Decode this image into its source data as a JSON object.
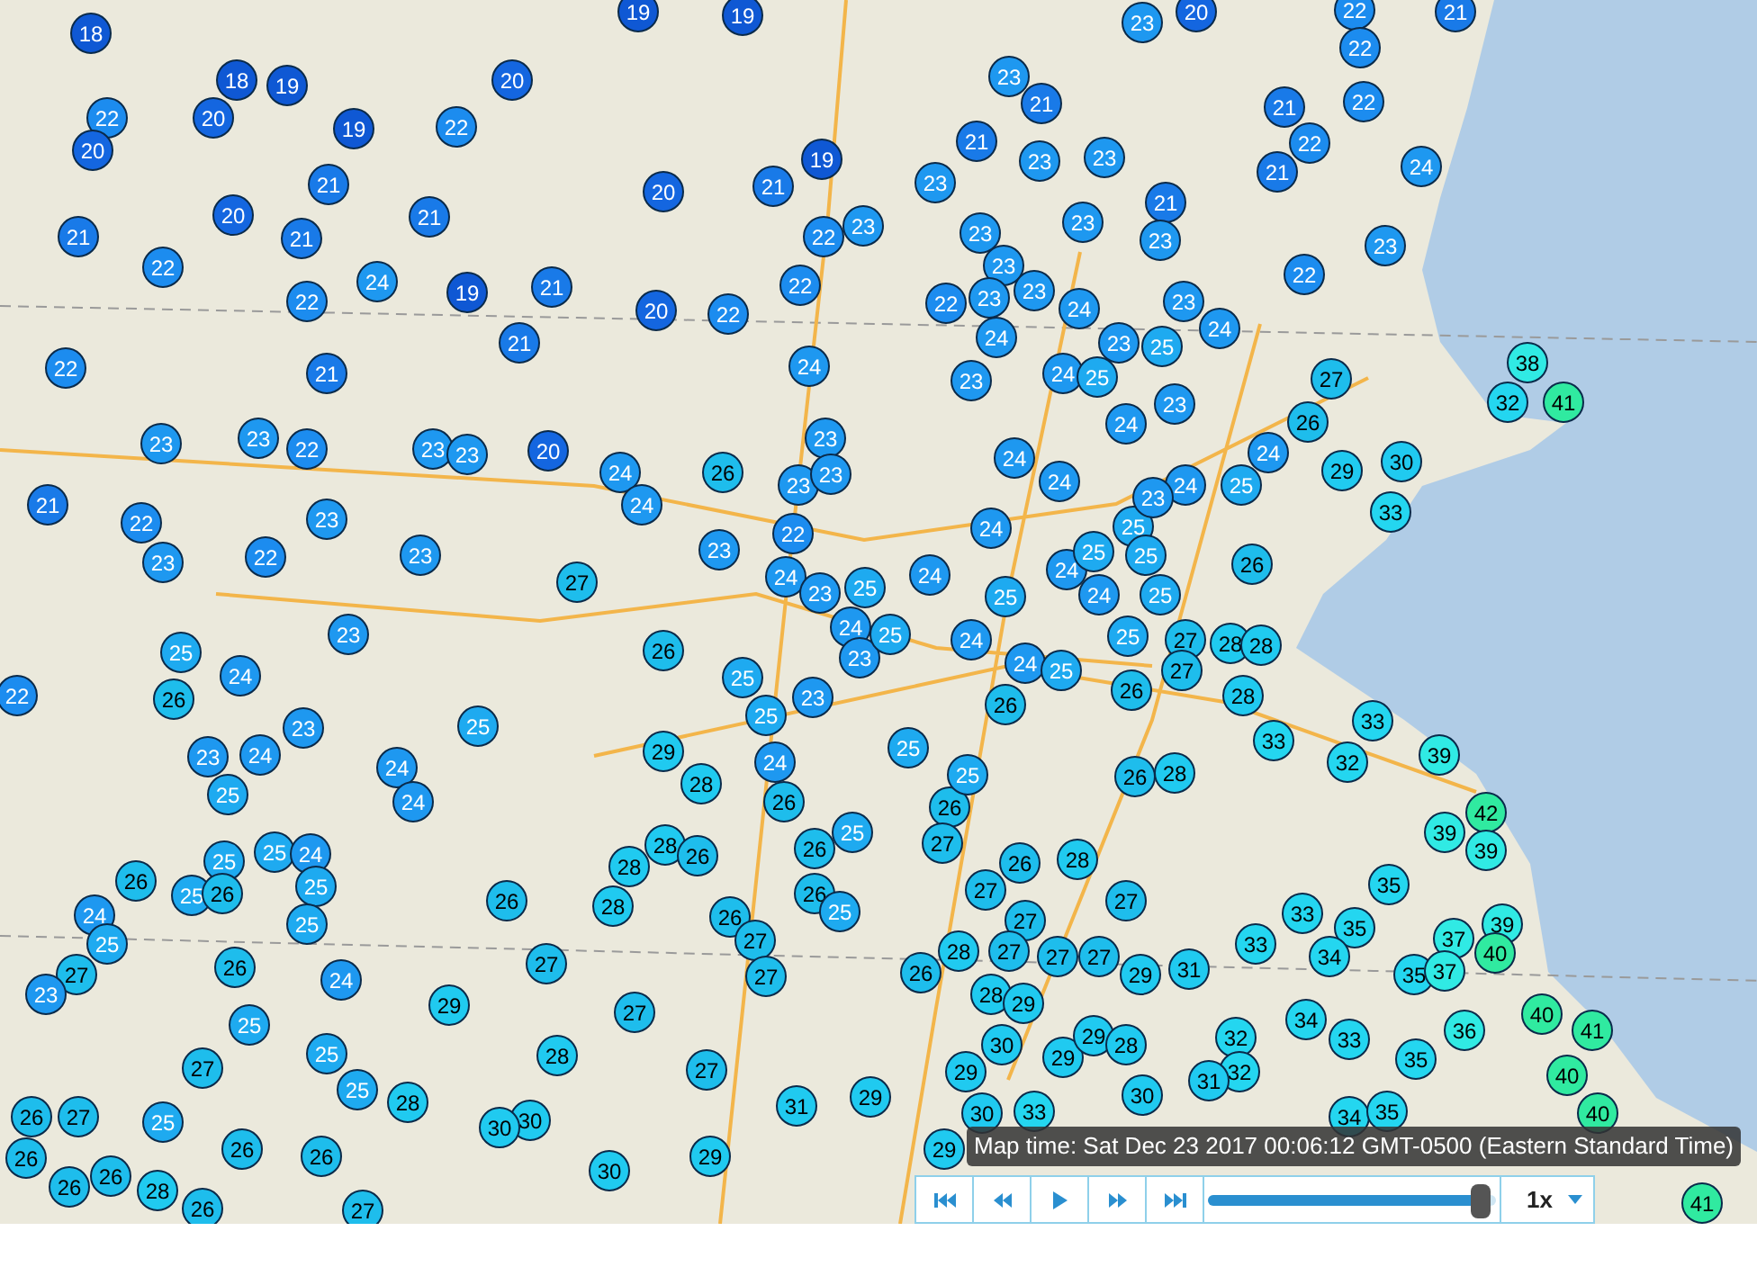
{
  "stations": [
    "18",
    "19",
    "19",
    "23",
    "20",
    "22",
    "21",
    "18",
    "19",
    "20",
    "23",
    "22",
    "22",
    "20",
    "19",
    "22",
    "21",
    "21",
    "22",
    "20",
    "19",
    "21",
    "23",
    "23",
    "21",
    "22",
    "24",
    "20",
    "21",
    "21",
    "20",
    "21",
    "23",
    "23",
    "21",
    "21",
    "22",
    "21",
    "22",
    "23",
    "23",
    "23",
    "23",
    "23",
    "22",
    "24",
    "19",
    "21",
    "20",
    "22",
    "22",
    "22",
    "23",
    "23",
    "24",
    "23",
    "22",
    "21",
    "24",
    "23",
    "25",
    "24",
    "22",
    "21",
    "24",
    "23",
    "24",
    "25",
    "23",
    "27",
    "32",
    "38",
    "41",
    "23",
    "23",
    "22",
    "23",
    "23",
    "24",
    "26",
    "23",
    "20",
    "24",
    "26",
    "23",
    "23",
    "24",
    "24",
    "24",
    "25",
    "24",
    "29",
    "30",
    "21",
    "22",
    "23",
    "24",
    "22",
    "24",
    "25",
    "23",
    "33",
    "23",
    "22",
    "23",
    "27",
    "23",
    "24",
    "24",
    "24",
    "25",
    "25",
    "26",
    "23",
    "24",
    "25",
    "25",
    "24",
    "25",
    "25",
    "23",
    "26",
    "23",
    "25",
    "24",
    "24",
    "25",
    "25",
    "27",
    "27",
    "28",
    "28",
    "22",
    "26",
    "24",
    "25",
    "25",
    "23",
    "26",
    "26",
    "28",
    "23",
    "24",
    "23",
    "25",
    "29",
    "24",
    "25",
    "33",
    "32",
    "33",
    "39",
    "25",
    "24",
    "24",
    "28",
    "26",
    "26",
    "25",
    "26",
    "28",
    "25",
    "24",
    "28",
    "26",
    "25",
    "27",
    "39",
    "42",
    "39",
    "26",
    "25",
    "25",
    "26",
    "25",
    "28",
    "26",
    "26",
    "27",
    "26",
    "28",
    "35",
    "24",
    "25",
    "25",
    "26",
    "28",
    "26",
    "27",
    "25",
    "27",
    "27",
    "33",
    "33",
    "35",
    "37",
    "39",
    "27",
    "26",
    "24",
    "27",
    "27",
    "26",
    "28",
    "27",
    "27",
    "27",
    "29",
    "31",
    "34",
    "35",
    "37",
    "40",
    "23",
    "25",
    "29",
    "27",
    "28",
    "29",
    "34",
    "36",
    "40",
    "41",
    "27",
    "25",
    "28",
    "27",
    "29",
    "30",
    "29",
    "29",
    "28",
    "32",
    "32",
    "33",
    "35",
    "40",
    "26",
    "27",
    "25",
    "25",
    "28",
    "30",
    "31",
    "29",
    "30",
    "33",
    "30",
    "31",
    "34",
    "35",
    "40",
    "26",
    "26",
    "26",
    "30",
    "29",
    "29",
    "26",
    "26",
    "28",
    "26",
    "27",
    "30",
    "41"
  ],
  "map_time": "Map time: Sat Dec 23 2017 00:06:12 GMT-0500 (Eastern Standard Time)",
  "playback": {
    "level": 0.98,
    "speed": "1x"
  }
}
